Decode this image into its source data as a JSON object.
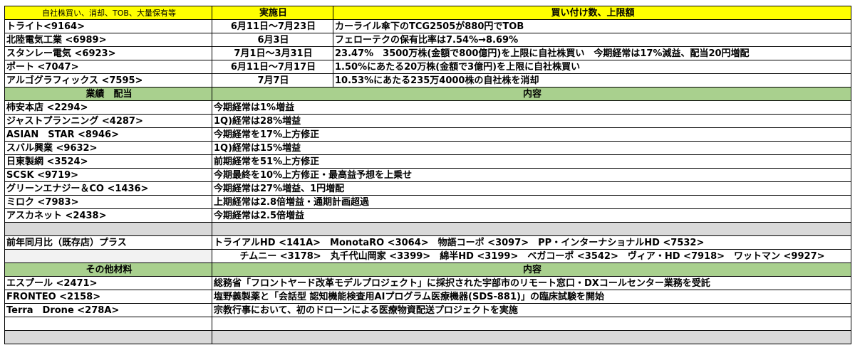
{
  "buyback": {
    "headers": [
      "自社株買い、消却、TOB、大量保有等",
      "実施日",
      "買い付け数、上限額"
    ],
    "rows": [
      {
        "name": "トライト<9164>",
        "date": "6月11日～7月23日",
        "detail": "カーライル傘下のTCG2505が880円でTOB",
        "red": true
      },
      {
        "name": "北陸電気工業 <6989>",
        "date": "6月3日",
        "detail": "フェローテクの保有比率は7.54%→8.69%",
        "red": false
      },
      {
        "name": "スタンレー電気 <6923>",
        "date": "7月1日～3月31日",
        "detail": "23.47%　3500万株(金額で800億円)を上限に自社株買い　今期経常は17%減益、配当20円増配",
        "red": true
      },
      {
        "name": "ポート <7047>",
        "date": "6月11日～7月17日",
        "detail": "1.50%にあたる20万株(金額で3億円)を上限に自社株買い",
        "red": true
      },
      {
        "name": "アルゴグラフィックス <7595>",
        "date": "7月7日",
        "detail": "10.53%にあたる235万4000株の自社株を消却",
        "red": true
      }
    ]
  },
  "earnings": {
    "headers": [
      "業績　配当",
      "内容"
    ],
    "rows": [
      {
        "name": "柿安本店 <2294>",
        "detail": "今期経常は1%増益",
        "red": false
      },
      {
        "name": "ジャストプランニング <4287>",
        "detail": "1Q)経常は28%増益",
        "red": false
      },
      {
        "name": "ASIAN　STAR <8946>",
        "detail": "今期経常を17%上方修正",
        "red": true
      },
      {
        "name": "スバル興業 <9632>",
        "detail": "1Q)経常は15%増益",
        "red": false
      },
      {
        "name": "日東製網 <3524>",
        "detail": "前期経常を51%上方修正",
        "red": false
      },
      {
        "name": "SCSK <9719>",
        "detail": "今期最終を10%上方修正・最高益予想を上乗せ",
        "red": false
      },
      {
        "name": "グリーンエナジー＆CO <1436>",
        "detail": "今期経常は27%増益、1円増配",
        "red": false
      },
      {
        "name": "ミロク <7983>",
        "detail": "上期経常は2.8倍増益・通期計画超過",
        "red": true
      },
      {
        "name": "アスカネット <2438>",
        "detail": "今期経常は2.5倍増益",
        "red": true
      }
    ]
  },
  "sales": {
    "label": "前年同月比（既存店）プラス",
    "line1": "トライアルHD <141A>　MonotaRO <3064>　物語コーポ <3097>　PP・インターナショナルHD <7532>",
    "line2": "チムニー <3178>　丸千代山岡家 <3399>　綿半HD <3199>　ベガコーポ <3542>　ヴィア・HD <7918>　ワットマン <9927>"
  },
  "other": {
    "headers": [
      "その他材料",
      "内容"
    ],
    "rows": [
      {
        "name": "エスプール <2471>",
        "detail": "総務省「フロントヤード改革モデルプロジェクト」に採択された宇部市のリモート窓口・DXコールセンター業務を受託",
        "red": false
      },
      {
        "name": "FRONTEO <2158>",
        "detail": "塩野義製薬と「会話型 認知機能検査用AIプログラム医療機器(SDS-881)」の臨床試験を開始",
        "red": true
      },
      {
        "name": "Terra　Drone <278A>",
        "detail": "宗教行事において、初のドローンによる医療物資配送プロジェクトを実施",
        "red": false
      }
    ]
  },
  "colors": {
    "header": "#ffff00",
    "section": "#a9d08e",
    "highlight": "#ff0000",
    "blank": "#d9d9d9"
  }
}
